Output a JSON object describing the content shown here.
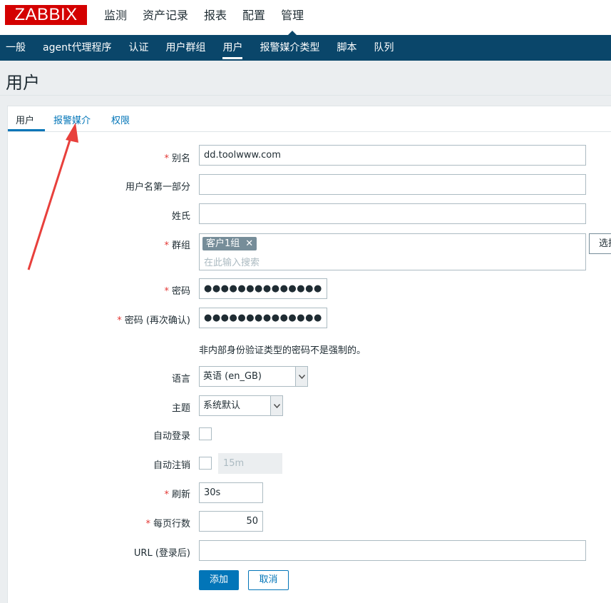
{
  "logo": "ZABBIX",
  "main_nav": [
    "监测",
    "资产记录",
    "报表",
    "配置",
    "管理"
  ],
  "sub_nav": [
    "一般",
    "agent代理程序",
    "认证",
    "用户群组",
    "用户",
    "报警媒介类型",
    "脚本",
    "队列"
  ],
  "page_title": "用户",
  "tabs": [
    "用户",
    "报警媒介",
    "权限"
  ],
  "form": {
    "alias_label": "别名",
    "alias_value": "dd.toolwww.com",
    "name_label": "用户名第一部分",
    "name_value": "",
    "surname_label": "姓氏",
    "surname_value": "",
    "groups_label": "群组",
    "group_chip": "客户1组",
    "groups_placeholder": "在此输入搜索",
    "select_button": "选择",
    "password_label": "密码",
    "password_value": "●●●●●●●●●●●●●●",
    "password_confirm_label": "密码 (再次确认)",
    "password_confirm_value": "●●●●●●●●●●●●●●",
    "password_note": "非内部身份验证类型的密码不是强制的。",
    "language_label": "语言",
    "language_value": "英语 (en_GB)",
    "theme_label": "主题",
    "theme_value": "系统默认",
    "autologin_label": "自动登录",
    "autologout_label": "自动注销",
    "autologout_value": "15m",
    "refresh_label": "刷新",
    "refresh_value": "30s",
    "rows_label": "每页行数",
    "rows_value": "50",
    "url_label": "URL (登录后)",
    "url_value": "",
    "add_button": "添加",
    "cancel_button": "取消"
  },
  "colors": {
    "logo_bg": "#d40000",
    "subnav_bg": "#0a466a",
    "accent": "#0275b8",
    "required": "#e33734",
    "annotation_arrow": "#e8403c"
  }
}
